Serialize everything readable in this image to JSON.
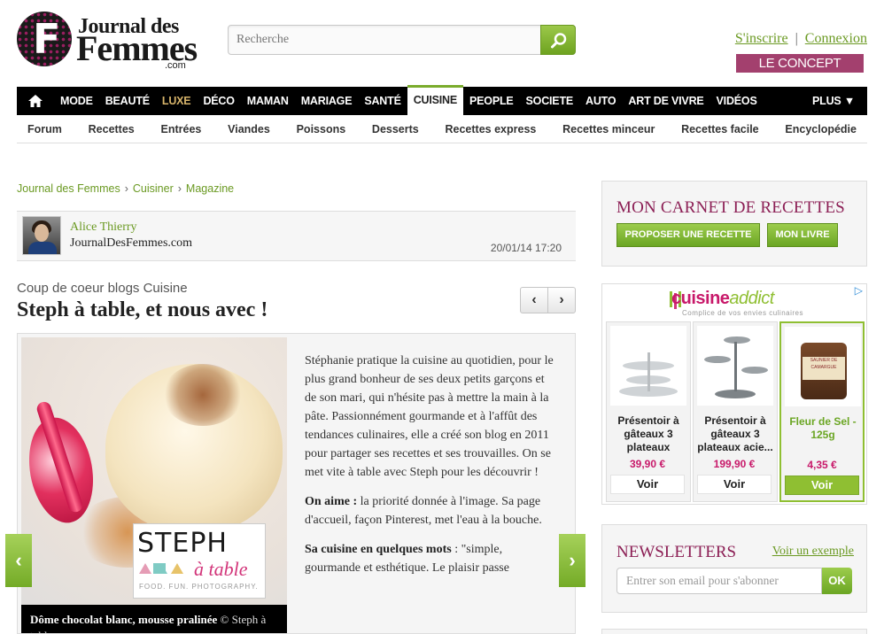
{
  "header": {
    "logo_line1": "Journal des",
    "logo_line2": "Femmes",
    "logo_line3": ".com",
    "logo_mark": "F",
    "search_placeholder": "Recherche",
    "signup": "S'inscrire",
    "separator": "|",
    "login": "Connexion",
    "concept_store": "LE CONCEPT STORE"
  },
  "mainnav": {
    "items": [
      "MODE",
      "BEAUTÉ",
      "LUXE",
      "DÉCO",
      "MAMAN",
      "MARIAGE",
      "SANTÉ",
      "CUISINE",
      "PEOPLE",
      "SOCIETE",
      "AUTO",
      "ART DE VIVRE",
      "VIDÉOS"
    ],
    "more": "PLUS ▼",
    "active": "CUISINE"
  },
  "subnav": {
    "items": [
      "Forum",
      "Recettes",
      "Entrées",
      "Viandes",
      "Poissons",
      "Desserts",
      "Recettes express",
      "Recettes minceur",
      "Recettes facile",
      "Encyclopédie"
    ]
  },
  "breadcrumb": {
    "items": [
      "Journal des Femmes",
      "Cuisiner",
      "Magazine"
    ],
    "sep": "›"
  },
  "author": {
    "name": "Alice Thierry",
    "site": "JournalDesFemmes.com",
    "date": "20/01/14 17:20"
  },
  "article": {
    "kicker": "Coup de coeur blogs Cuisine",
    "title": "Steph à table, et nous avec !",
    "prev": "‹",
    "next": "›",
    "para1": "Stéphanie pratique la cuisine au quotidien, pour le plus grand bonheur de ses deux petits garçons et de son mari, qui n'hésite pas à mettre la main à la pâte. Passionnément gourmande et à l'affût des tendances culinaires, elle a créé son blog en 2011 pour partager ses recettes et ses trouvailles. On se met vite à table avec Steph pour les découvrir !",
    "p2_label": "On aime :",
    "p2_text": " la priorité donnée à l'image. Sa page d'accueil, façon Pinterest, met l'eau à la bouche.",
    "p3_label": "Sa cuisine en quelques mots",
    "p3_text": " : \"simple, gourmande et esthétique. Le plaisir passe",
    "caption": "Dôme chocolat blanc, mousse pralinée",
    "caption_credit": " © Steph à table",
    "badge_word1": "STEPH",
    "badge_word2": "à table",
    "badge_tagline": "FOOD. FUN. PHOTOGRAPHY.",
    "slide_prev": "‹",
    "slide_next": "›"
  },
  "sidebar": {
    "carnet_title": "MON CARNET DE RECETTES",
    "propose_button": "PROPOSER UNE RECETTE",
    "book_button": "MON LIVRE",
    "ad": {
      "brand_main": "cuisine",
      "brand_sub": "addict",
      "tagline": "Complice de vos envies culinaires",
      "adchoice": "▷",
      "products": [
        {
          "name": "Présentoir à gâteaux 3 plateaux",
          "price": "39,90 €",
          "button": "Voir"
        },
        {
          "name": "Présentoir à gâteaux 3 plateaux acie...",
          "price": "199,90 €",
          "button": "Voir"
        },
        {
          "name": "Fleur de Sel - 125g",
          "price": "4,35 €",
          "button": "Voir"
        }
      ],
      "salt_label": "SAUNIER DE CAMARGUE"
    },
    "newsletter_title": "NEWSLETTERS",
    "newsletter_example": "Voir un exemple",
    "newsletter_placeholder": "Entrer son email pour s'abonner",
    "newsletter_ok": "OK"
  }
}
